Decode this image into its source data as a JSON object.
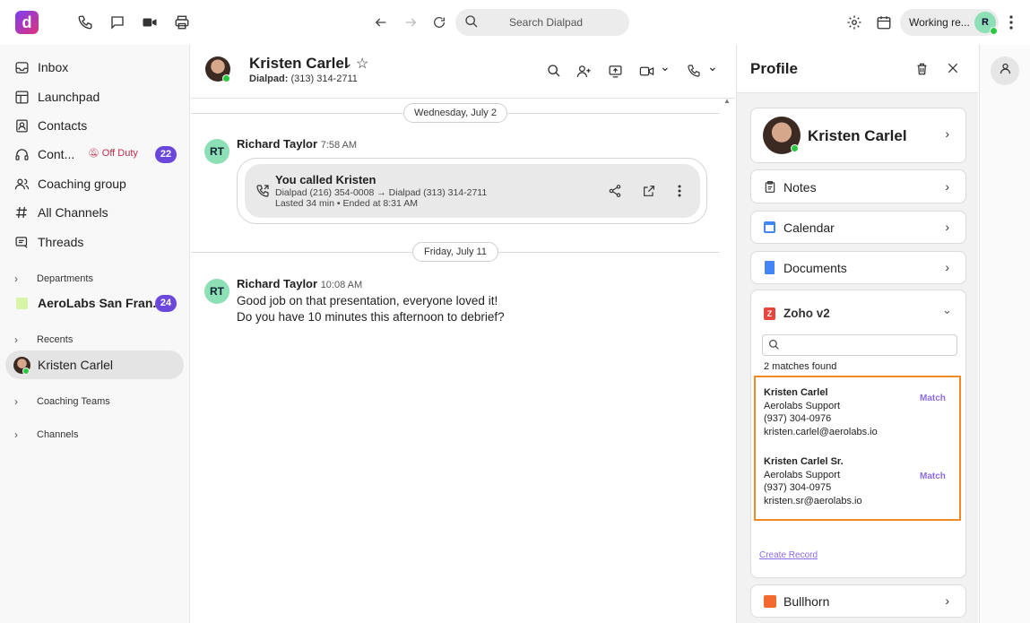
{
  "topbar": {
    "search_placeholder": "Search Dialpad",
    "status": "Working re...",
    "avatar_initial": "R"
  },
  "sidebar": {
    "items": [
      {
        "label": "Inbox",
        "icon": "inbox-icon"
      },
      {
        "label": "Launchpad",
        "icon": "launchpad-icon"
      },
      {
        "label": "Contacts",
        "icon": "contacts-icon"
      },
      {
        "label": "Cont...",
        "icon": "headset-icon",
        "status": "Off Duty",
        "badge": "22"
      },
      {
        "label": "Coaching group",
        "icon": "people-icon"
      },
      {
        "label": "All Channels",
        "icon": "hash-icon"
      },
      {
        "label": "Threads",
        "icon": "threads-icon"
      }
    ],
    "departments_label": "Departments",
    "department": {
      "label": "AeroLabs San Fran...",
      "badge": "24"
    },
    "recents_label": "Recents",
    "recent": {
      "label": "Kristen Carlel"
    },
    "coaching_teams_label": "Coaching Teams",
    "channels_label": "Channels"
  },
  "chat": {
    "contact_name": "Kristen Carlel",
    "dialpad_label": "Dialpad:",
    "dialpad_number": "(313) 314-2711",
    "date1": "Wednesday, July 2",
    "date2": "Friday, July 11",
    "msg1": {
      "initials": "RT",
      "sender": "Richard Taylor",
      "time": "7:58 AM",
      "call_title": "You called Kristen",
      "call_line1": "Dialpad (216) 354-0008 → Dialpad (313) 314-2711",
      "call_line2": "Lasted 34 min • Ended at 8:31 AM"
    },
    "msg2": {
      "initials": "RT",
      "sender": "Richard Taylor",
      "time": "10:08 AM",
      "line1": "Good job on that presentation, everyone loved it!",
      "line2": "Do you have 10 minutes this afternoon to debrief?"
    }
  },
  "profile": {
    "title": "Profile",
    "name": "Kristen Carlel",
    "notes": "Notes",
    "calendar": "Calendar",
    "documents": "Documents",
    "zoho": {
      "title": "Zoho v2",
      "matches": "2 matches found",
      "results": [
        {
          "name": "Kristen Carlel",
          "company": "Aerolabs Support",
          "phone": "(937) 304-0976",
          "email": "kristen.carlel@aerolabs.io",
          "action": "Match"
        },
        {
          "name": "Kristen Carlel Sr.",
          "company": "Aerolabs Support",
          "phone": "(937) 304-0975",
          "email": "kristen.sr@aerolabs.io",
          "action": "Match"
        }
      ],
      "create": "Create Record"
    },
    "bullhorn": "Bullhorn"
  },
  "colors": {
    "accent": "#6b47dc",
    "highlight": "#f08a24",
    "online": "#28c840",
    "match": "#8c6be8"
  }
}
